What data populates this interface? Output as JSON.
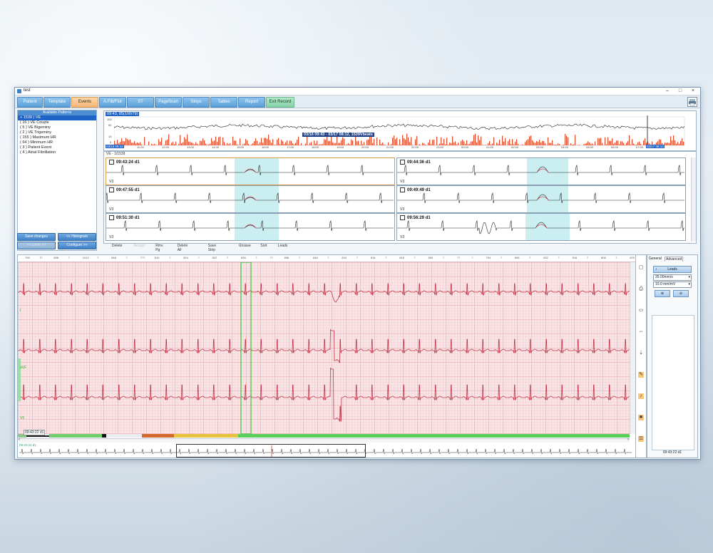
{
  "window": {
    "title": "test",
    "controls": [
      "–",
      "□",
      "×"
    ]
  },
  "nav": {
    "tabs": [
      {
        "label": "Patient"
      },
      {
        "label": "Template"
      },
      {
        "label": "Events"
      },
      {
        "label": "A.Fib/Flut"
      },
      {
        "label": "ST"
      },
      {
        "label": "PageScan"
      },
      {
        "label": "Strips"
      },
      {
        "label": "Tables"
      },
      {
        "label": "Report"
      },
      {
        "label": "Exit Record"
      }
    ],
    "active_tab": "Events"
  },
  "patterns": {
    "title": "Available Patterns",
    "items": [
      {
        "label": "1539  ) VE"
      },
      {
        "label": "16   ) VE Couple"
      },
      {
        "label": "5   ) VE Bigeminy"
      },
      {
        "label": "2   ) VE Trigeminy"
      },
      {
        "label": "155   ) Maximum HR"
      },
      {
        "label": "64   ) Minimum HR"
      },
      {
        "label": "3   ) Patient Event"
      },
      {
        "label": "4   ) Atrial Fibrillation"
      }
    ],
    "prefixes": [
      "+",
      "(",
      "(",
      "(",
      "(",
      "(",
      "(",
      "("
    ],
    "buttons": {
      "save_changes": "Save changes",
      "histogram": "<< Histogram",
      "undo": "<< Undo >>",
      "configure": "Configure >>"
    }
  },
  "trend": {
    "header": "09:43, 85(100/79)",
    "banner": "03/16 09:43 - 03/17 08:12, 1539Vbeats",
    "y_ticks": [
      "100",
      "50",
      "10",
      "5"
    ],
    "time_left": "03/16 09:43",
    "time_right": "03/17 08:13",
    "x_ticks": [
      "11:00",
      "12:00",
      "13:00",
      "14:00",
      "15:00",
      "16:00",
      "17:00",
      "18:00",
      "19:00",
      "20:00",
      "21:00",
      "22:00",
      "23:00",
      "00:00",
      "01:00",
      "02:00",
      "03:00",
      "04:00",
      "05:00",
      "06:00",
      "07:00"
    ]
  },
  "strips": {
    "header": "VE - 1/1539",
    "items": [
      {
        "time": "09:43:24 d1",
        "lead": "V3"
      },
      {
        "time": "09:44:36 d1",
        "lead": "V3"
      },
      {
        "time": "09:47:55 d1",
        "lead": "V3"
      },
      {
        "time": "09:49:49 d1",
        "lead": "V3"
      },
      {
        "time": "09:51:30 d1",
        "lead": "V3"
      },
      {
        "time": "09:56:29 d1",
        "lead": "V3"
      }
    ],
    "actions": [
      "Delete",
      "Accept",
      "Rmv Pg",
      "Delete All",
      "Save Strip",
      "Unsave",
      "Sort",
      "Leads"
    ]
  },
  "ecg": {
    "rr_labels": [
      "799",
      "7?",
      "808",
      "?",
      "1012",
      "?",
      "848",
      "?",
      "7??",
      "816",
      "?",
      "824",
      "?",
      "822",
      "?",
      "838",
      "?",
      "??",
      "806",
      "?",
      "848",
      "?",
      "824",
      "?",
      "816",
      "?",
      "818",
      "?",
      "800",
      "?",
      "??",
      "?",
      "794",
      "?",
      "808",
      "?",
      "832",
      "?",
      "816",
      "?",
      "808",
      "?",
      "820"
    ],
    "lead_markers": [
      "I",
      "aVF",
      "V5"
    ],
    "timestamp": "09:43:22 d1",
    "mini_label": "09:43:24 d1"
  },
  "settings": {
    "tabs": [
      "General",
      "Advanced"
    ],
    "leads_button": "Leads",
    "speed": "25.00mm/s",
    "gain": "10.0 mm/mV",
    "footer_time": "09:43:22 d1"
  },
  "colors": {
    "accent": "#4d8fd0",
    "active_tab": "#f6b578",
    "exit_tab": "#86d2a7",
    "ecg_trace": "#c2374a",
    "highlight": "#cbeff0"
  }
}
